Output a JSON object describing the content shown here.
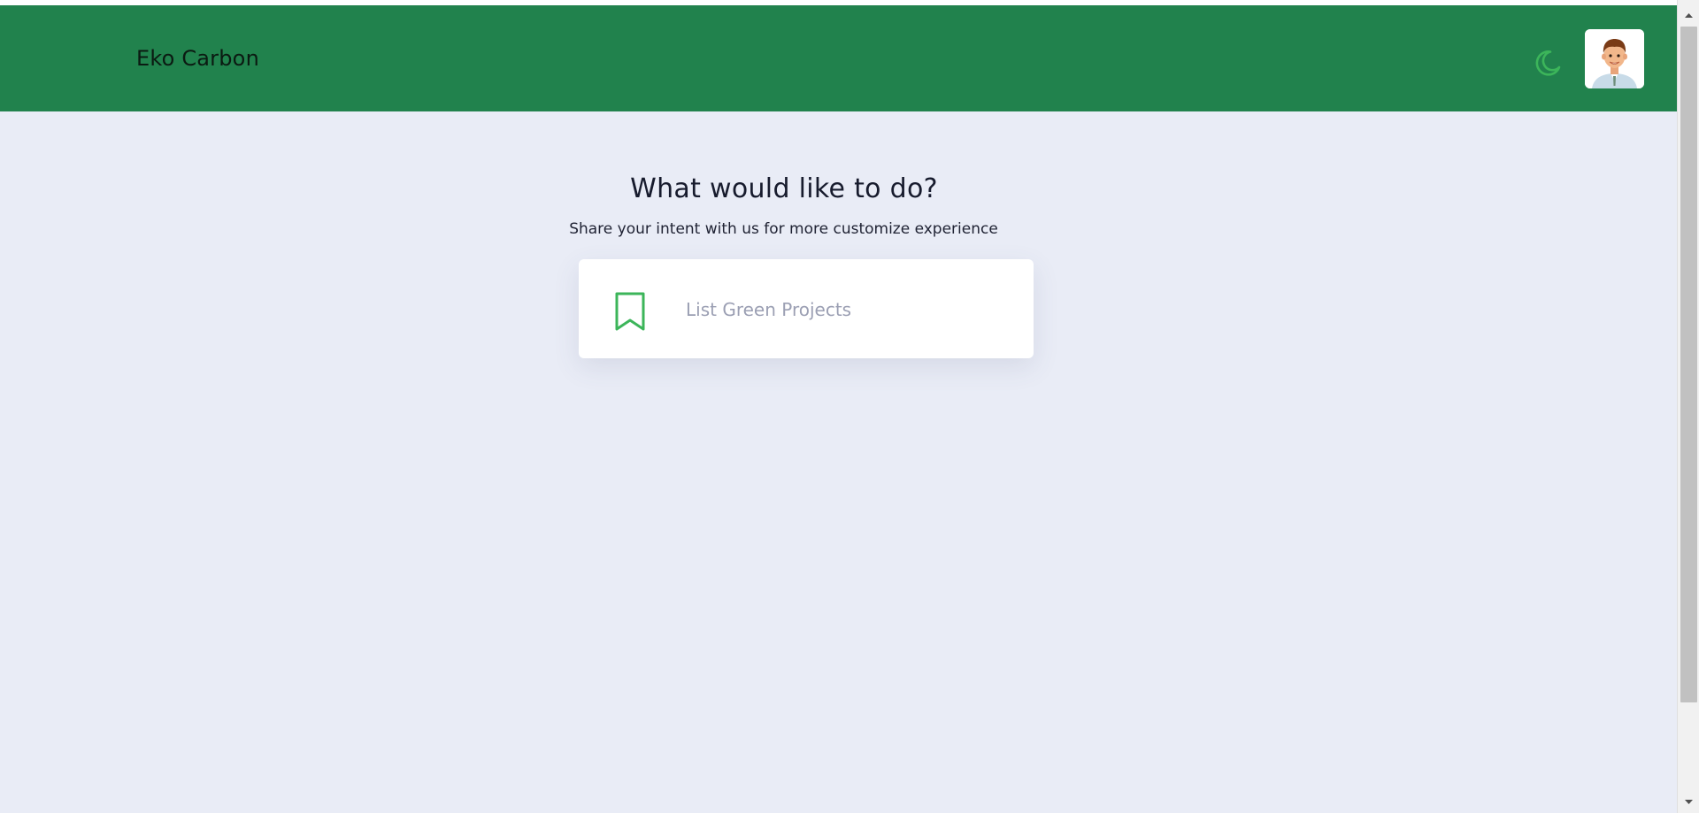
{
  "header": {
    "brand": "Eko Carbon",
    "theme_toggle_icon": "moon-icon",
    "avatar_icon": "user-avatar-icon",
    "bar_color": "#21824d",
    "accent_color": "#3cb55a"
  },
  "main": {
    "heading": "What would like to do?",
    "subheading": "Share your intent with us for more customize experience",
    "options": [
      {
        "label": "List Green Projects",
        "icon": "bookmark-icon"
      }
    ]
  }
}
